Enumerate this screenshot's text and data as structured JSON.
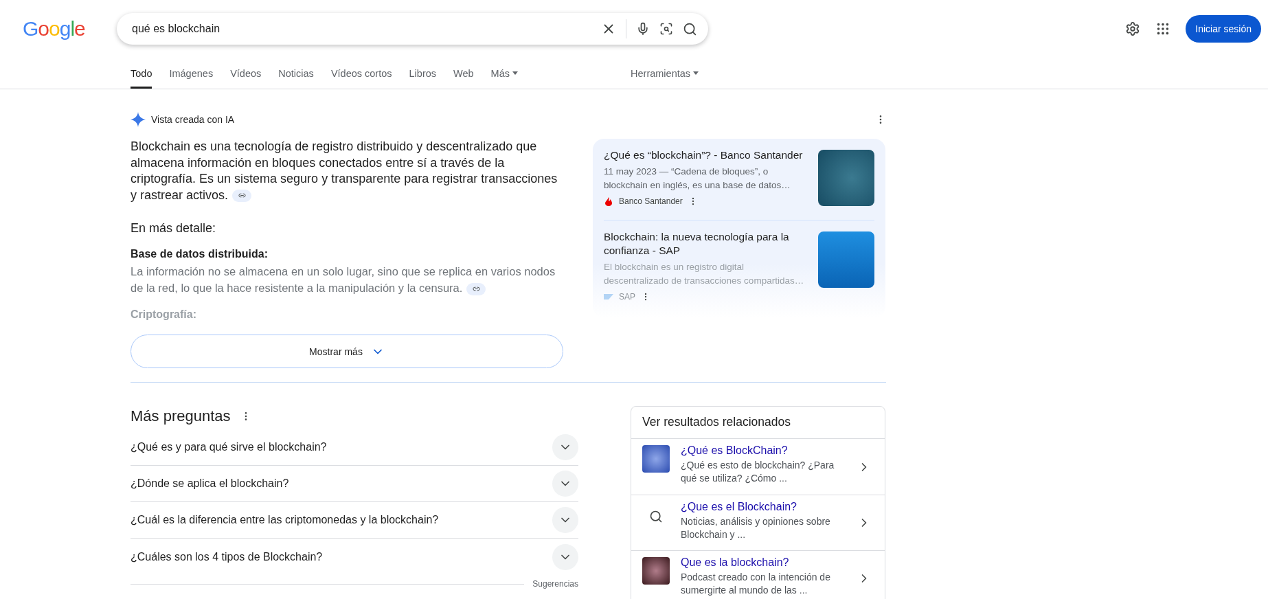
{
  "logo": "Google",
  "search": {
    "value": "qué es blockchain"
  },
  "sign_in": "Iniciar sesión",
  "tabs": [
    {
      "label": "Todo",
      "selected": true,
      "dropdown": false
    },
    {
      "label": "Imágenes",
      "selected": false,
      "dropdown": false
    },
    {
      "label": "Vídeos",
      "selected": false,
      "dropdown": false
    },
    {
      "label": "Noticias",
      "selected": false,
      "dropdown": false
    },
    {
      "label": "Vídeos cortos",
      "selected": false,
      "dropdown": false
    },
    {
      "label": "Libros",
      "selected": false,
      "dropdown": false
    },
    {
      "label": "Web",
      "selected": false,
      "dropdown": false
    },
    {
      "label": "Más",
      "selected": false,
      "dropdown": true
    }
  ],
  "tools": "Herramientas",
  "ai_overview": {
    "label": "Vista creada con IA",
    "summary": "Blockchain es una tecnología de registro distribuido y descentralizado que almacena información en bloques conectados entre sí a través de la criptografía. Es un sistema seguro y transparente para registrar transacciones y rastrear activos.",
    "summary_citation": true,
    "detail_heading": "En más detalle:",
    "details": [
      {
        "title": "Base de datos distribuida:",
        "text": "La información no se almacena en un solo lugar, sino que se replica en varios nodos de la red, lo que la hace resistente a la manipulación y la censura.",
        "citation": true,
        "faded": false
      },
      {
        "title": "Criptografía:",
        "faded": true
      }
    ],
    "show_more": "Mostrar más",
    "sources": [
      {
        "title": "¿Qué es “blockchain”? - Banco Santander",
        "snippet": "11 may 2023 — “Cadena de bloques”, o blockchain en inglés, es una base de datos…",
        "site": "Banco Santander",
        "kind": "photo",
        "faded": false
      },
      {
        "title": "Blockchain: la nueva tecnología para la confianza - SAP",
        "snippet": "El blockchain es un registro digital descentralizado de transacciones compartidas…",
        "site": "SAP",
        "kind": "logo",
        "faded": true
      }
    ]
  },
  "people_also_ask": {
    "title": "Más preguntas",
    "questions": [
      {
        "text": "¿Qué es y para qué sirve el blockchain?",
        "expanded": false
      },
      {
        "text": "¿Dónde se aplica el blockchain?",
        "expanded": false
      },
      {
        "text": "¿Cuál es la diferencia entre las criptomonedas y la blockchain?",
        "expanded": false
      },
      {
        "text": "¿Cuáles son los 4 tipos de Blockchain?",
        "expanded": false
      }
    ],
    "footer": "Sugerencias"
  },
  "related": {
    "title": "Ver resultados relacionados",
    "items": [
      {
        "kind": "image",
        "title": "¿Qué es BlockChain?",
        "text": "¿Qué es esto de blockchain? ¿Para qué se utiliza? ¿Cómo ..."
      },
      {
        "kind": "search",
        "title": "¿Que es el Blockchain?",
        "text": "Noticias, análisis y opiniones sobre Blockchain y ..."
      },
      {
        "kind": "image",
        "title": "Que es la blockchain?",
        "text": "Podcast creado con la intención de sumergirte al mundo de las ..."
      }
    ]
  }
}
